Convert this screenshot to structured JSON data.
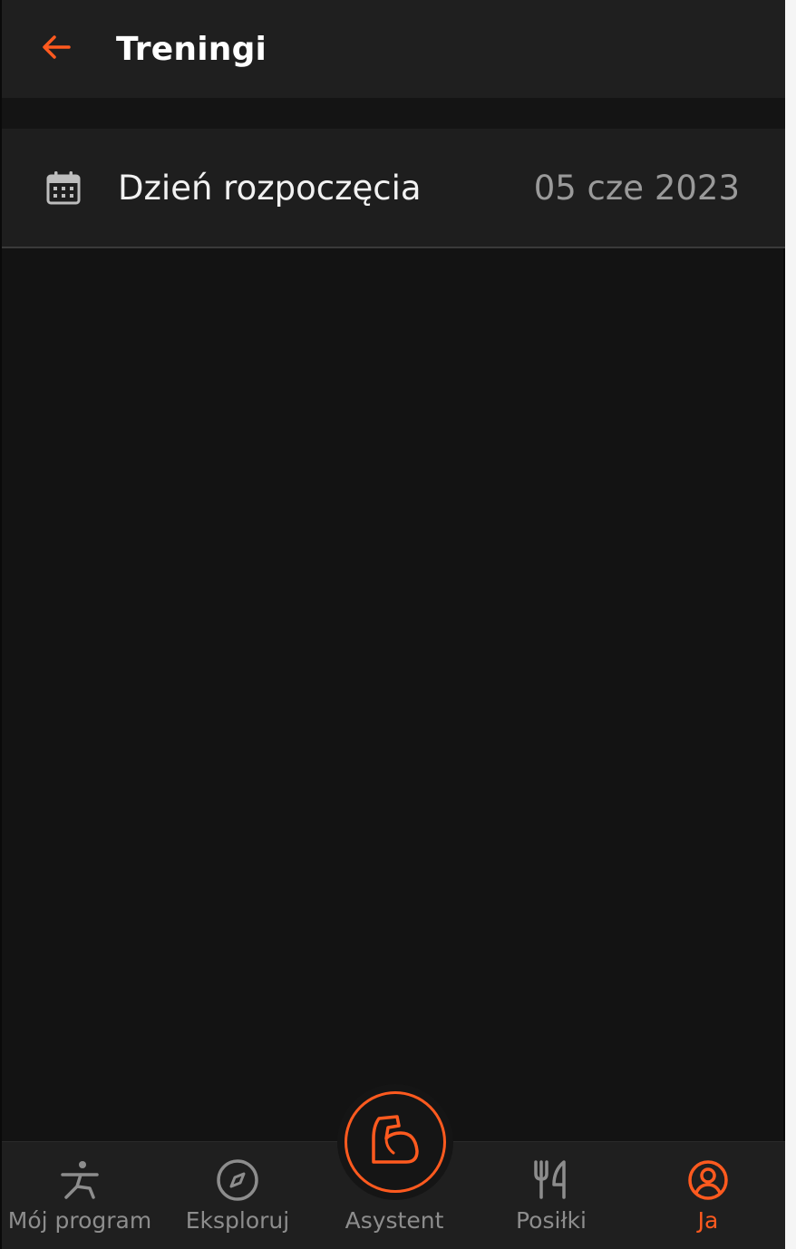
{
  "header": {
    "title": "Treningi",
    "back_icon": "arrow-left-icon"
  },
  "settings": {
    "start_day": {
      "icon": "calendar-icon",
      "label": "Dzień rozpoczęcia",
      "value": "05 cze 2023"
    }
  },
  "bottom_nav": {
    "items": [
      {
        "label": "Mój program",
        "icon": "yoga-pose-icon",
        "active": false
      },
      {
        "label": "Eksploruj",
        "icon": "compass-icon",
        "active": false
      },
      {
        "label": "Asystent",
        "icon": "flexed-arm-icon",
        "active": false
      },
      {
        "label": "Posiłki",
        "icon": "fork-knife-icon",
        "active": false
      },
      {
        "label": "Ja",
        "icon": "user-circle-icon",
        "active": true
      }
    ]
  },
  "colors": {
    "accent": "#ff5a1f",
    "background": "#131313",
    "surface": "#1f1f1f",
    "muted_text": "#8d8d8d"
  }
}
